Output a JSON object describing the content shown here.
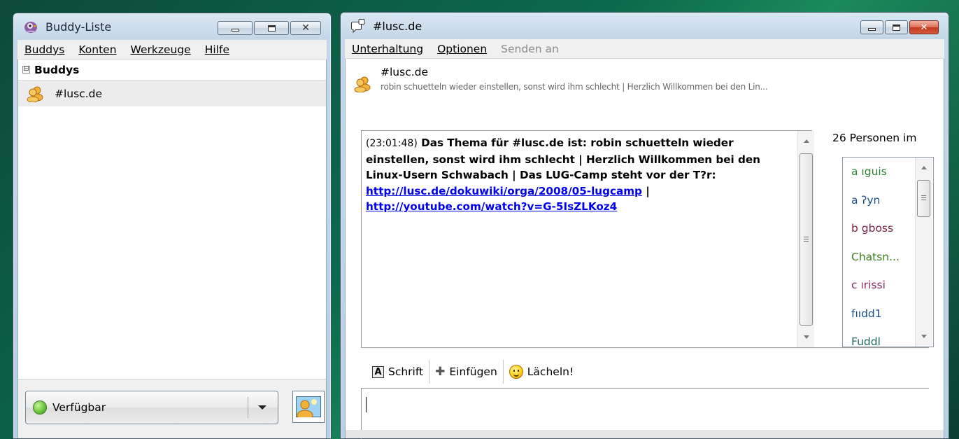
{
  "buddy_window": {
    "title": "Buddy-Liste",
    "menu": [
      "Buddys",
      "Konten",
      "Werkzeuge",
      "Hilfe"
    ],
    "group": {
      "label": "Buddys",
      "toggle": "⊟"
    },
    "buddies": [
      {
        "name": "#lusc.de",
        "icon": "chat-group-icon"
      }
    ],
    "status": {
      "label": "Verfügbar",
      "color": "#5cb833"
    }
  },
  "chat_window": {
    "title": "#lusc.de",
    "menu": [
      "Unterhaltung",
      "Optionen",
      "Senden an"
    ],
    "header": {
      "name": "#lusc.de",
      "topic": "robin schuetteln wieder einstellen, sonst wird ihm schlecht | Herzlich Willkommen bei den Lin..."
    },
    "log": {
      "timestamp": "(23:01:48)",
      "message_part1": "Das Thema für #lusc.de ist: robin schuetteln wieder einstellen, sonst wird ihm schlecht | Herzlich Willkommen bei den Linux-Usern Schwabach | Das LUG-Camp steht vor der T?r: ",
      "link1": "http://lusc.de/dokuwiki/orga/2008/05-lugcamp",
      "separator": " | ",
      "link2": "http://youtube.com/watch?v=G-5IsZLKoz4"
    },
    "users": {
      "count_label": "26 Personen im",
      "list": [
        {
          "name": "a ıguis",
          "color": "#2e7d32"
        },
        {
          "name": "a ʔyn",
          "color": "#1a4f8b"
        },
        {
          "name": "b gboss",
          "color": "#7a1f3d"
        },
        {
          "name": "Chatsn...",
          "color": "#3a7d1e"
        },
        {
          "name": "c ırissi",
          "color": "#8a2b6a"
        },
        {
          "name": "fııdd1",
          "color": "#1a4f8b"
        },
        {
          "name": "Fuddl",
          "color": "#1f6a5a"
        }
      ]
    },
    "toolbar": {
      "font": "Schrift",
      "insert": "Einfügen",
      "smile": "Lächeln!"
    },
    "input_value": ""
  }
}
